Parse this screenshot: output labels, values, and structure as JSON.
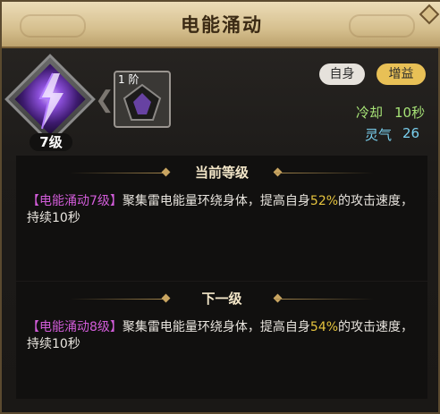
{
  "header": {
    "title": "电能涌动"
  },
  "skill": {
    "icon": "lightning-figure-icon",
    "level_label": "7级",
    "rank_label": "1 阶",
    "tags": {
      "self": "自身",
      "buff": "增益"
    },
    "cooldown": {
      "label": "冷却",
      "value": "10秒"
    },
    "spirit": {
      "label": "灵气",
      "value": "26"
    }
  },
  "current": {
    "header": "当前等级",
    "name": "【电能涌动7级】",
    "text_a": "聚集雷电能量环绕身体，提高自身",
    "percent": "52%",
    "text_b": "的攻击速度，持续10秒"
  },
  "next": {
    "header": "下一级",
    "name": "【电能涌动8级】",
    "text_a": "聚集雷电能量环绕身体，提高自身",
    "percent": "54%",
    "text_b": "的攻击速度，持续10秒"
  },
  "colors": {
    "title_bar": "#d6c08f",
    "skill_name": "#d15cd8",
    "percent": "#e6c43e",
    "cooldown": "#a6e276",
    "spirit": "#7ad0ef",
    "buff_tag": "#e8c056"
  }
}
